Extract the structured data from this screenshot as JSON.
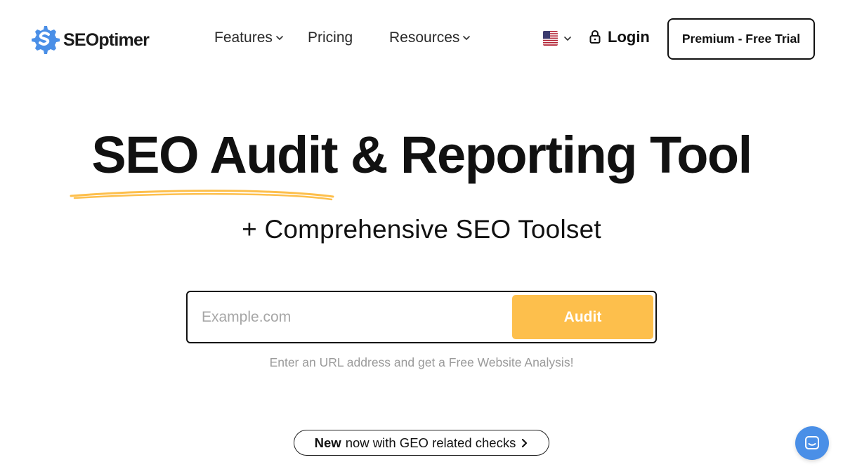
{
  "brand": {
    "name": "SEOptimer",
    "accent": "#fdbf4c",
    "logo_blue": "#4a8fe7"
  },
  "nav": {
    "items": [
      {
        "label": "Features",
        "dropdown": true
      },
      {
        "label": "Pricing",
        "dropdown": false
      },
      {
        "label": "Resources",
        "dropdown": true
      }
    ],
    "language_icon": "us-flag-icon",
    "login_label": "Login",
    "login_icon": "lock-icon",
    "cta_label": "Premium - Free Trial"
  },
  "hero": {
    "title": "SEO Audit & Reporting Tool",
    "subtitle": "+ Comprehensive SEO Toolset"
  },
  "search": {
    "placeholder": "Example.com",
    "value": "",
    "button_label": "Audit",
    "hint": "Enter an URL address and get a Free Website Analysis!"
  },
  "announcement": {
    "strong": "New",
    "text": "now with GEO related checks",
    "icon": "chevron-right-icon"
  },
  "chat": {
    "icon": "chat-icon",
    "color": "#4a8fe7"
  }
}
